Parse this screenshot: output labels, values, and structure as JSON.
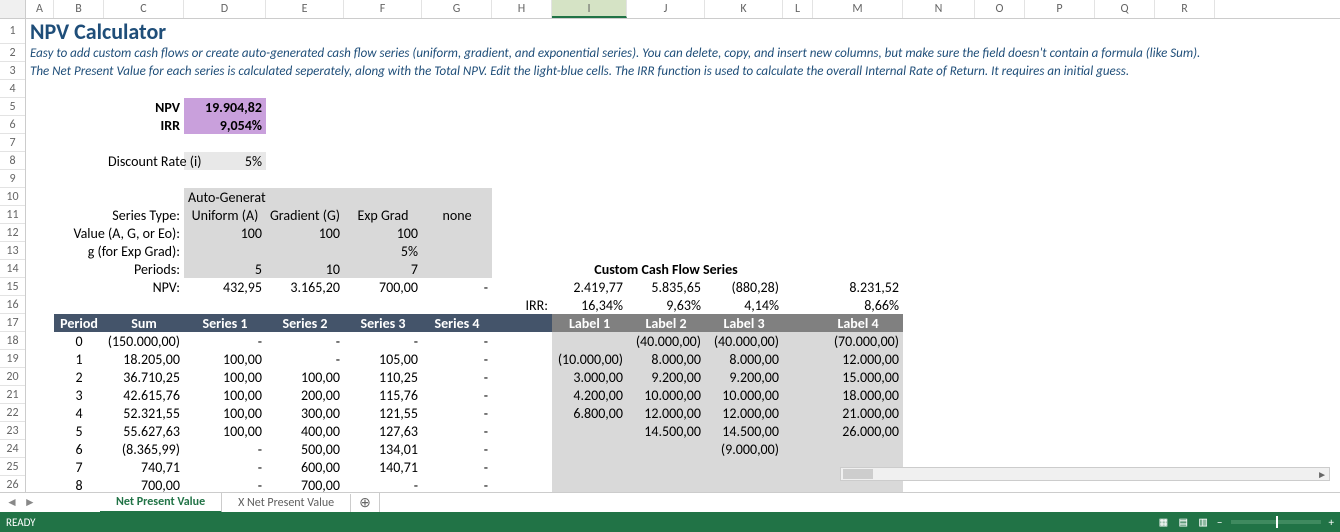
{
  "cols": [
    "A",
    "B",
    "C",
    "D",
    "E",
    "F",
    "G",
    "H",
    "I",
    "J",
    "K",
    "L",
    "M",
    "N",
    "O",
    "P",
    "Q",
    "R"
  ],
  "selected_col": "I",
  "row_nums": [
    1,
    2,
    3,
    4,
    5,
    6,
    7,
    8,
    9,
    10,
    11,
    12,
    13,
    14,
    15,
    16,
    17,
    18,
    19,
    20,
    21,
    22,
    23,
    24,
    25,
    26
  ],
  "title": "NPV Calculator",
  "desc1": "Easy to add custom cash flows or create auto-generated cash flow series (uniform, gradient, and exponential series). You can delete, copy, and insert new columns, but make sure the field doesn't contain a formula (like Sum).",
  "desc2": "The Net Present Value for each series is calculated seperately, along with the Total NPV. Edit the light-blue cells. The IRR function is used to calculate the overall Internal Rate of Return. It requires an initial guess.",
  "labels": {
    "npv": "NPV",
    "irr": "IRR",
    "discount": "Discount Rate (i)",
    "autogen": "Auto-Generated Cash Flow Series",
    "series_type": "Series Type:",
    "value_age": "Value (A, G, or Eo):",
    "g_exp": "g (for Exp Grad):",
    "periods": "Periods:",
    "npv_row": "NPV:",
    "irr_row": "IRR:",
    "custom": "Custom Cash Flow Series"
  },
  "summary": {
    "npv_val": "19.904,82",
    "irr_val": "9,054%",
    "discount_val": "5%"
  },
  "series_types": {
    "d": "Uniform (A)",
    "e": "Gradient (G)",
    "f": "Exp Grad",
    "g": "none"
  },
  "series_vals": {
    "d": "100",
    "e": "100",
    "f": "100"
  },
  "g_vals": {
    "f": "5%"
  },
  "periods_vals": {
    "d": "5",
    "e": "10",
    "f": "7"
  },
  "npv_row": {
    "d": "432,95",
    "e": "3.165,20",
    "f": "700,00",
    "g": "-",
    "i": "2.419,77",
    "j": "5.835,65",
    "k": "(880,28)",
    "m": "8.231,52"
  },
  "irr_row": {
    "i": "16,34%",
    "j": "9,63%",
    "k": "4,14%",
    "m": "8,66%"
  },
  "headers": {
    "b": "Period",
    "c": "Sum",
    "d": "Series 1",
    "e": "Series 2",
    "f": "Series 3",
    "g": "Series 4",
    "i": "Label 1",
    "j": "Label 2",
    "k": "Label 3",
    "m": "Label 4"
  },
  "rows": [
    {
      "b": "0",
      "c": "(150.000,00)",
      "d": "-",
      "e": "-",
      "f": "-",
      "g": "-",
      "i": "",
      "j": "(40.000,00)",
      "k": "(40.000,00)",
      "m": "(70.000,00)"
    },
    {
      "b": "1",
      "c": "18.205,00",
      "d": "100,00",
      "e": "-",
      "f": "105,00",
      "g": "-",
      "i": "(10.000,00)",
      "j": "8.000,00",
      "k": "8.000,00",
      "m": "12.000,00"
    },
    {
      "b": "2",
      "c": "36.710,25",
      "d": "100,00",
      "e": "100,00",
      "f": "110,25",
      "g": "-",
      "i": "3.000,00",
      "j": "9.200,00",
      "k": "9.200,00",
      "m": "15.000,00"
    },
    {
      "b": "3",
      "c": "42.615,76",
      "d": "100,00",
      "e": "200,00",
      "f": "115,76",
      "g": "-",
      "i": "4.200,00",
      "j": "10.000,00",
      "k": "10.000,00",
      "m": "18.000,00"
    },
    {
      "b": "4",
      "c": "52.321,55",
      "d": "100,00",
      "e": "300,00",
      "f": "121,55",
      "g": "-",
      "i": "6.800,00",
      "j": "12.000,00",
      "k": "12.000,00",
      "m": "21.000,00"
    },
    {
      "b": "5",
      "c": "55.627,63",
      "d": "100,00",
      "e": "400,00",
      "f": "127,63",
      "g": "-",
      "i": "",
      "j": "14.500,00",
      "k": "14.500,00",
      "m": "26.000,00"
    },
    {
      "b": "6",
      "c": "(8.365,99)",
      "d": "-",
      "e": "500,00",
      "f": "134,01",
      "g": "-",
      "i": "",
      "j": "",
      "k": "(9.000,00)",
      "m": ""
    },
    {
      "b": "7",
      "c": "740,71",
      "d": "-",
      "e": "600,00",
      "f": "140,71",
      "g": "-",
      "i": "",
      "j": "",
      "k": "",
      "m": ""
    },
    {
      "b": "8",
      "c": "700,00",
      "d": "-",
      "e": "700,00",
      "f": "-",
      "g": "-",
      "i": "",
      "j": "",
      "k": "",
      "m": ""
    }
  ],
  "tabs": {
    "active": "Net Present Value",
    "inactive": "X Net Present Value"
  },
  "status": {
    "ready": "READY",
    "zoom_minus": "−",
    "zoom_plus": "+"
  }
}
